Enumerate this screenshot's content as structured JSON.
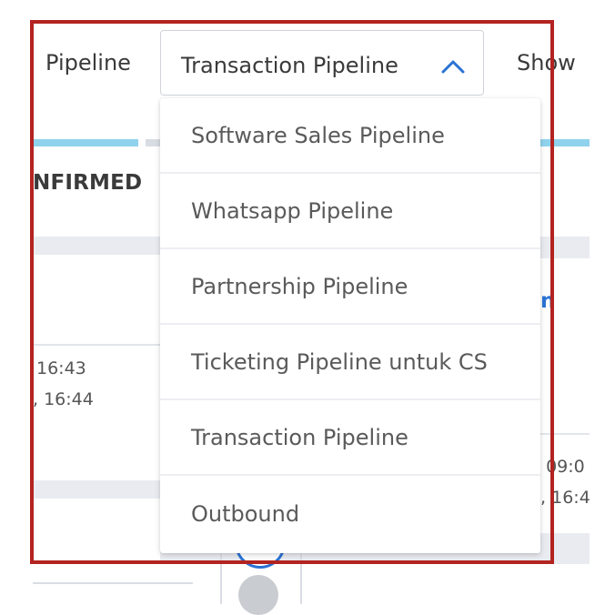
{
  "toolbar": {
    "pipeline_label": "Pipeline",
    "selected_pipeline": "Transaction Pipeline",
    "show_label": "Show"
  },
  "board": {
    "column_header": "NFIRMED",
    "left_card": {
      "time_1": "16:43",
      "time_2": ", 16:44"
    },
    "right_card": {
      "link_fragment": "n",
      "time_1": ", 09:0",
      "time_2": "., 16:4"
    }
  },
  "dropdown": {
    "options": [
      "Software Sales Pipeline",
      "Whatsapp Pipeline",
      "Partnership Pipeline",
      "Ticketing Pipeline untuk CS",
      "Transaction Pipeline",
      "Outbound"
    ]
  },
  "colors": {
    "accent": "#2a72d4",
    "highlight_frame": "#b32420",
    "progress_bar": "#8fd2ec"
  },
  "icons": {
    "dropdown_toggle": "chevron-up-icon"
  }
}
